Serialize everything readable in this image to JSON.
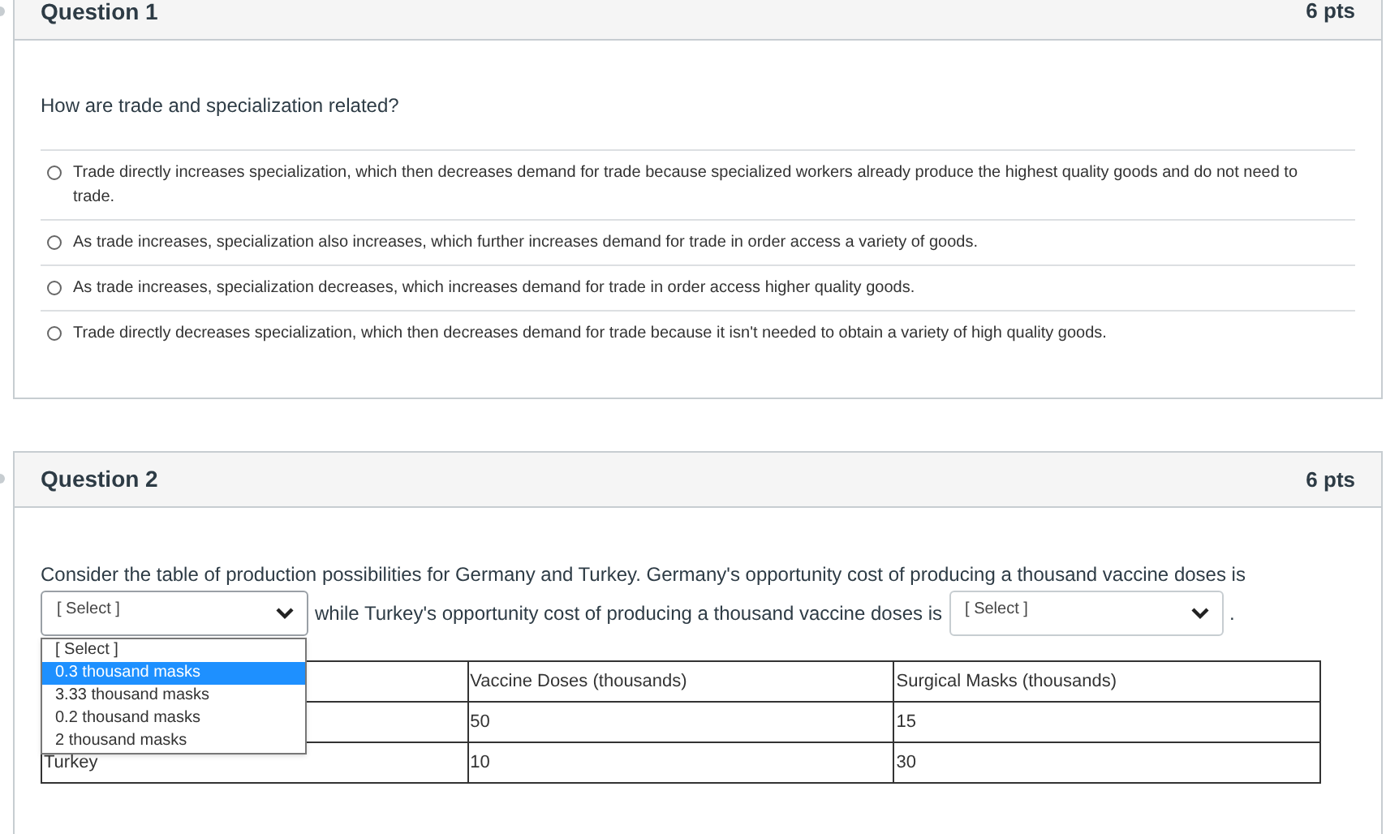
{
  "questions": [
    {
      "title": "Question 1",
      "points": "6 pts",
      "prompt": "How are trade and specialization related?",
      "options": [
        {
          "label": "Trade directly increases specialization, which then decreases demand for trade because specialized workers already produce the highest quality goods and do not need to trade.",
          "selected": false
        },
        {
          "label": "As trade increases, specialization also increases, which further increases demand for trade in order access a variety of goods.",
          "selected": false
        },
        {
          "label": "As trade increases, specialization decreases, which increases demand for trade in order access higher quality goods.",
          "selected": false
        },
        {
          "label": "Trade directly decreases specialization, which then decreases demand for trade because it isn't needed to obtain a variety of high quality goods.",
          "selected": false
        }
      ]
    },
    {
      "title": "Question 2",
      "points": "6 pts",
      "text_1": "Consider the table of production possibilities for Germany and Turkey. Germany's opportunity cost of producing a thousand vaccine doses is",
      "select_1": {
        "value": "[ Select ]",
        "expanded": true,
        "options": [
          {
            "label": "[ Select ]",
            "highlighted": false
          },
          {
            "label": "0.3 thousand masks",
            "highlighted": true
          },
          {
            "label": "3.33 thousand masks",
            "highlighted": false
          },
          {
            "label": "0.2 thousand masks",
            "highlighted": false
          },
          {
            "label": "2 thousand masks",
            "highlighted": false
          }
        ]
      },
      "text_2": "while Turkey's opportunity cost of producing a thousand vaccine doses is",
      "select_2": {
        "value": "[ Select ]",
        "expanded": false
      },
      "text_3": ".",
      "table": {
        "columns": [
          "Vaccine Doses (thousands)",
          "Surgical Masks (thousands)"
        ],
        "rows": [
          {
            "cells": [
              "50",
              "15"
            ]
          },
          {
            "name": "Turkey",
            "cells": [
              "10",
              "30"
            ]
          }
        ]
      }
    }
  ]
}
